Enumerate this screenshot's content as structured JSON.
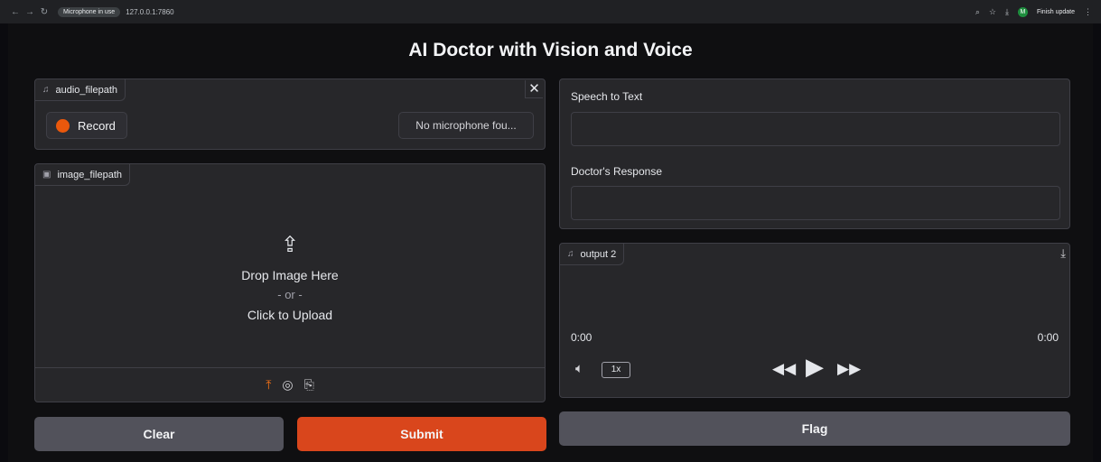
{
  "browser": {
    "tab_badge": "Microphone in use",
    "url": "127.0.0.1:7860",
    "avatar_letter": "M",
    "finish_update": "Finish update"
  },
  "app": {
    "title": "AI Doctor with Vision and Voice"
  },
  "audio_input": {
    "label": "audio_filepath",
    "record_label": "Record",
    "mic_select": "No microphone fou..."
  },
  "image_input": {
    "label": "image_filepath",
    "drop_text": "Drop Image Here",
    "or_text": "- or -",
    "click_text": "Click to Upload"
  },
  "buttons": {
    "clear": "Clear",
    "submit": "Submit",
    "flag": "Flag"
  },
  "outputs": {
    "speech_label": "Speech to Text",
    "speech_value": "",
    "response_label": "Doctor's Response",
    "response_value": ""
  },
  "audio_output": {
    "label": "output 2",
    "time_current": "0:00",
    "time_total": "0:00",
    "speed": "1x"
  },
  "colors": {
    "accent": "#d9461c",
    "record_dot": "#ea580c",
    "background": "#0f0f11",
    "panel": "#27272a"
  }
}
